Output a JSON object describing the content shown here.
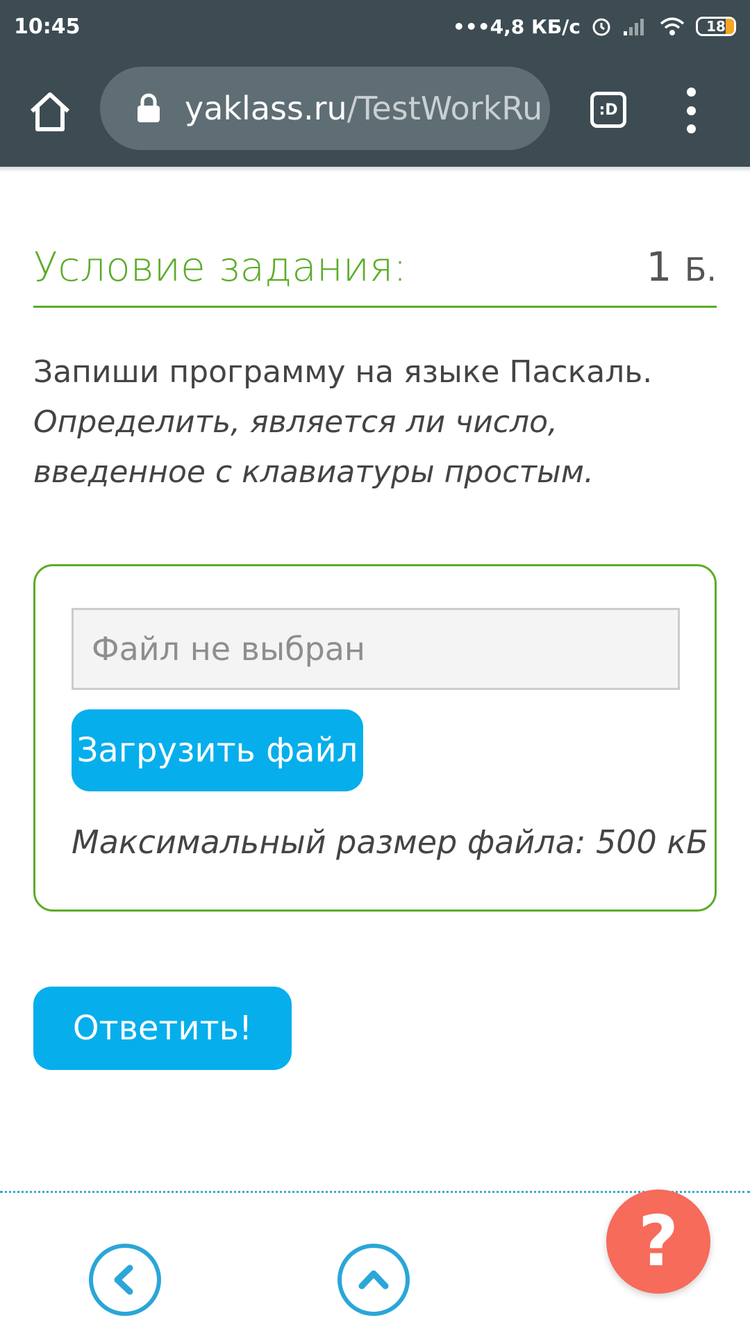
{
  "status_bar": {
    "time": "10:45",
    "network_speed": "•••4,8 КБ/с",
    "battery": "18",
    "icons": [
      "alarm-icon",
      "signal-icon",
      "wifi-icon",
      "battery-icon"
    ]
  },
  "browser": {
    "url_domain": "yaklass.ru",
    "url_path": "/TestWorkRu",
    "tab_label": ":D",
    "icons": [
      "home-icon",
      "lock-icon",
      "tabs-icon",
      "menu-icon"
    ]
  },
  "task": {
    "title": "Условие задания:",
    "points": "1",
    "points_unit": "Б.",
    "instruction": "Запиши программу на языке Паскаль.",
    "description": "Определить, является ли число, введенное с клавиатуры простым."
  },
  "upload": {
    "file_field_text": "Файл не выбран",
    "upload_button": "Загрузить файл",
    "max_size": "Максимальный размер файла: 500 кБ"
  },
  "answer_button": "Ответить!",
  "footer": {
    "help": "?",
    "icons": [
      "back-arrow-icon",
      "up-arrow-icon",
      "help-icon"
    ]
  },
  "colors": {
    "accent_green": "#5aac28",
    "button_blue": "#06aeec",
    "help_red": "#f66b5a",
    "toolbar": "#3d4c52"
  }
}
